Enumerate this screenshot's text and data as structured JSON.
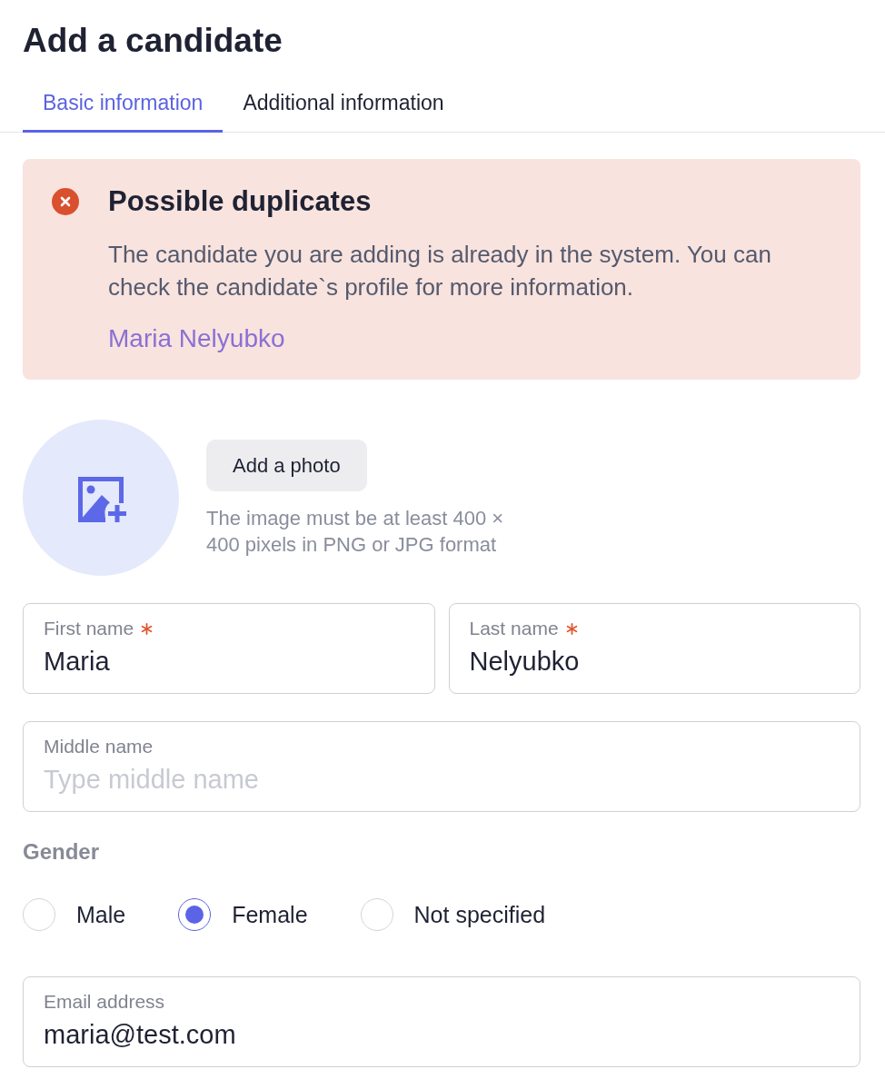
{
  "page": {
    "title": "Add a candidate"
  },
  "tabs": [
    {
      "label": "Basic information",
      "selected": true
    },
    {
      "label": "Additional information",
      "selected": false
    }
  ],
  "alert": {
    "title": "Possible duplicates",
    "message": "The candidate you are adding is already in the system. You can check the candidate`s profile for more information.",
    "link": "Maria Nelyubko"
  },
  "photo": {
    "button": "Add a photo",
    "hint": "The image must be at least 400 × 400 pixels in PNG or JPG format"
  },
  "name_fields": [
    {
      "label": "First name",
      "required": true,
      "value": "Maria"
    },
    {
      "label": "Last name",
      "required": true,
      "value": "Nelyubko"
    }
  ],
  "middle_name": {
    "label": "Middle name",
    "required": false,
    "placeholder": "Type middle name"
  },
  "gender": {
    "label": "Gender",
    "options": [
      {
        "label": "Male",
        "selected": false
      },
      {
        "label": "Female",
        "selected": true
      },
      {
        "label": "Not specified",
        "selected": false
      }
    ]
  },
  "email": {
    "label": "Email address",
    "required": false,
    "value": "maria@test.com"
  }
}
